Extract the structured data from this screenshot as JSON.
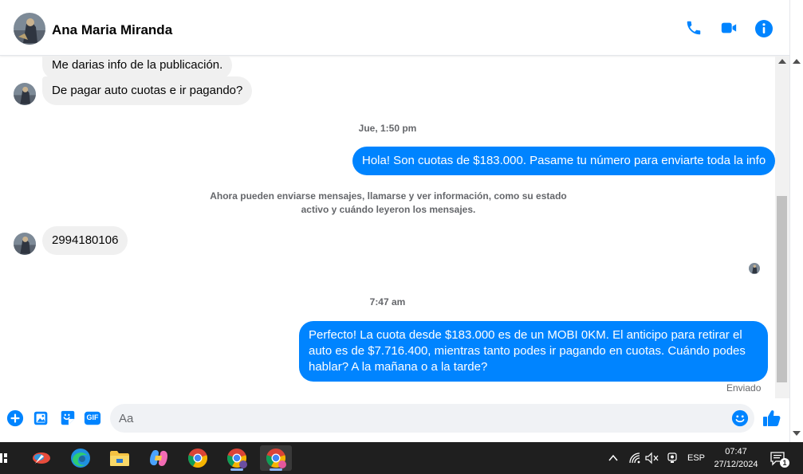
{
  "header": {
    "contact_name": "Ana Maria Miranda"
  },
  "messages": {
    "in_1": "Me darias info de la publicación.",
    "in_2": "De pagar auto cuotas e ir pagando?",
    "ts_1": "Jue, 1:50 pm",
    "out_1": "Hola! Son cuotas de $183.000. Pasame tu número para enviarte toda la info",
    "system_line_1": "Ahora pueden enviarse mensajes, llamarse y ver información, como su estado",
    "system_line_2": "activo y cuándo leyeron los mensajes.",
    "in_3": "2994180106",
    "ts_2": "7:47 am",
    "out_2": "Perfecto! La cuota desde $183.000 es de un MOBI 0KM. El anticipo para retirar el auto es de $7.716.400, mientras tanto podes ir pagando en cuotas. Cuándo podes hablar? A la mañana o a la tarde?",
    "status": "Enviado"
  },
  "composer": {
    "placeholder": "Aa",
    "gif_label": "GIF"
  },
  "taskbar": {
    "language": "ESP",
    "time": "07:47",
    "date": "27/12/2024",
    "notification_count": "1"
  },
  "colors": {
    "accent": "#0084ff",
    "incoming_bubble": "#f0f0f0",
    "taskbar": "#1f1f1f"
  }
}
